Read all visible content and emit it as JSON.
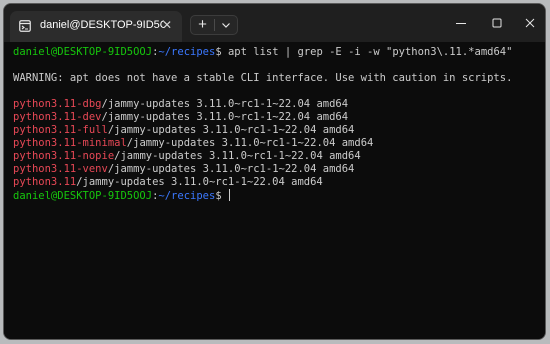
{
  "tab": {
    "title": "daniel@DESKTOP-9ID5OOJ: ~",
    "icon": "terminal-icon"
  },
  "titlebar": {
    "new_tab_icon": "plus-icon",
    "dropdown_icon": "chevron-down-icon",
    "minimize_icon": "minimize-icon",
    "maximize_icon": "maximize-icon",
    "close_icon": "close-icon"
  },
  "terminal": {
    "prompt1": {
      "user_host": "daniel@DESKTOP-9ID5OOJ",
      "colon": ":",
      "path": "~/recipes",
      "dollar": "$",
      "command": " apt list | grep -E -i -w \"python3\\.11.*amd64\""
    },
    "warning": "WARNING: apt does not have a stable CLI interface. Use with caution in scripts.",
    "results": [
      {
        "name": "python3.11-dbg",
        "rest": "/jammy-updates 3.11.0~rc1-1~22.04 amd64"
      },
      {
        "name": "python3.11-dev",
        "rest": "/jammy-updates 3.11.0~rc1-1~22.04 amd64"
      },
      {
        "name": "python3.11-full",
        "rest": "/jammy-updates 3.11.0~rc1-1~22.04 amd64"
      },
      {
        "name": "python3.11-minimal",
        "rest": "/jammy-updates 3.11.0~rc1-1~22.04 amd64"
      },
      {
        "name": "python3.11-nopie",
        "rest": "/jammy-updates 3.11.0~rc1-1~22.04 amd64"
      },
      {
        "name": "python3.11-venv",
        "rest": "/jammy-updates 3.11.0~rc1-1~22.04 amd64"
      },
      {
        "name": "python3.11",
        "rest": "/jammy-updates 3.11.0~rc1-1~22.04 amd64"
      }
    ],
    "prompt2": {
      "user_host": "daniel@DESKTOP-9ID5OOJ",
      "colon": ":",
      "path": "~/recipes",
      "dollar": "$"
    }
  },
  "colors": {
    "user_host": "#16c60c",
    "path": "#3b78ff",
    "package_match": "#e74856",
    "text": "#cccccc",
    "background": "#0c0c0c"
  }
}
